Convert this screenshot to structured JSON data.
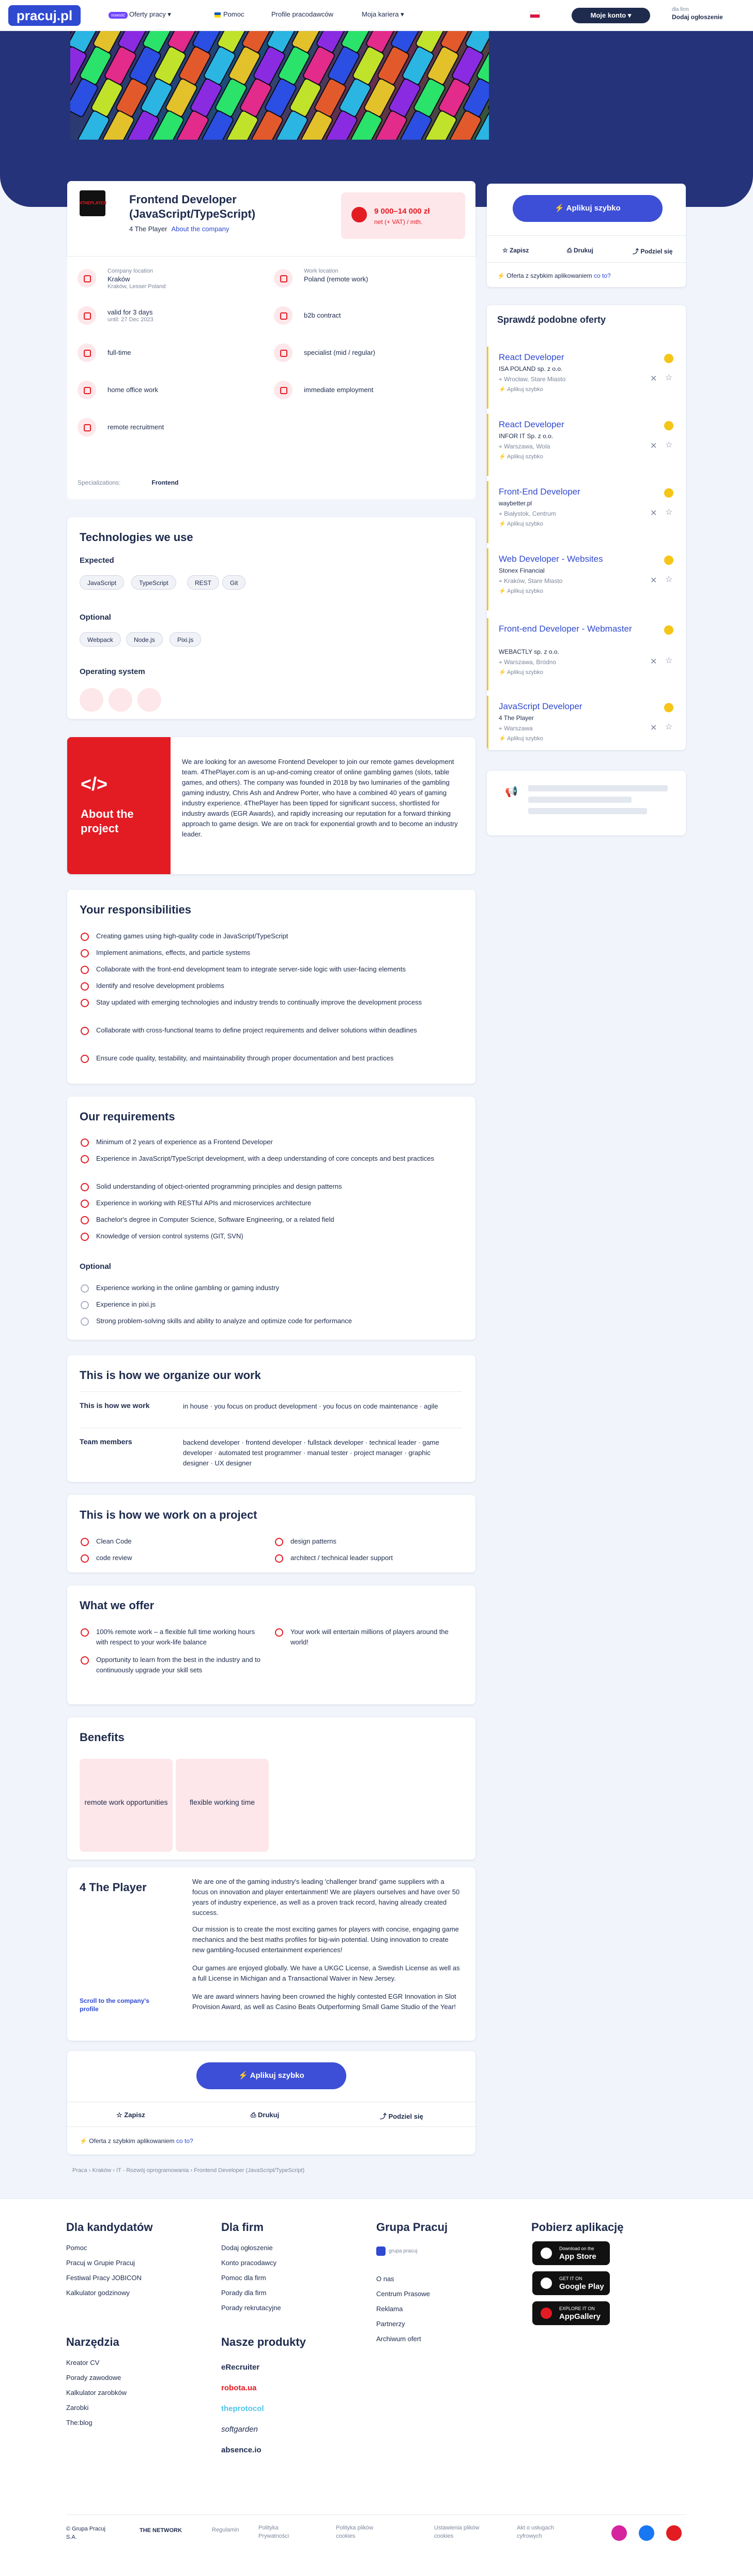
{
  "nav": {
    "logo": "pracuj.pl",
    "badge": "nowość",
    "items": [
      "Oferty pracy",
      "Pomoc",
      "Profile pracodawców",
      "Moja kariera"
    ],
    "employer_btn": "Moje konto",
    "firm_small": "dla firm",
    "firm_big": "Dodaj ogłoszenie"
  },
  "offer": {
    "company_logo": "4THEPLAYER",
    "title": "Frontend Developer (JavaScript/TypeScript)",
    "company": "4 The Player",
    "about_link": "About the company",
    "salary": "9 000–14 000 zł",
    "salary_note": "net (+ VAT) / mth."
  },
  "details": [
    {
      "title": "Company location",
      "value": "Kraków",
      "sub": "Kraków, Lesser Poland"
    },
    {
      "title": "Work location",
      "value": "Poland (remote work)",
      "sub": ""
    },
    {
      "value": "valid for 3 days",
      "sub": "until: 27 Dec 2023"
    },
    {
      "value": "b2b contract"
    },
    {
      "value": "full-time"
    },
    {
      "value": "specialist (mid / regular)"
    },
    {
      "value": "home office work"
    },
    {
      "value": "immediate employment"
    },
    {
      "value": "remote recruitment"
    }
  ],
  "specializations": {
    "label": "Specializations:",
    "value": "Frontend"
  },
  "tech": {
    "title": "Technologies we use",
    "expected": "Expected",
    "expected_items": [
      "JavaScript",
      "TypeScript",
      "REST",
      "Git"
    ],
    "optional": "Optional",
    "optional_items": [
      "Webpack",
      "Node.js",
      "Pixi.js"
    ],
    "os": "Operating system"
  },
  "project": {
    "title": "About the project",
    "text": "We are looking for an awesome Frontend Developer to join our remote games development team. 4ThePlayer.com is an up-and-coming creator of online gambling games (slots, table games, and others). The company was founded in 2018 by two luminaries of the gambling gaming industry, Chris Ash and Andrew Porter, who have a combined 40 years of gaming industry experience. 4ThePlayer has been tipped for significant success, shortlisted for industry awards (EGR Awards), and rapidly increasing our reputation for a forward thinking approach to game design. We are on track for exponential growth and to become an industry leader."
  },
  "responsibilities": {
    "title": "Your responsibilities",
    "items": [
      "Creating games using high-quality code in JavaScript/TypeScript",
      "Implement animations, effects, and particle systems",
      "Collaborate with the front-end development team to integrate server-side logic with user-facing elements",
      "Identify and resolve development problems",
      "Stay updated with emerging technologies and industry trends to continually improve the development process",
      "Collaborate with cross-functional teams to define project requirements and deliver solutions within deadlines",
      "Ensure code quality, testability, and maintainability through proper documentation and best practices"
    ]
  },
  "requirements": {
    "title": "Our requirements",
    "items": [
      "Minimum of 2 years of experience as a Frontend Developer",
      "Experience in JavaScript/TypeScript development, with a deep understanding of core concepts and best practices",
      "Solid understanding of object-oriented programming principles and design patterns",
      "Experience in working with RESTful APIs and microservices architecture",
      "Bachelor's degree in Computer Science, Software Engineering, or a related field",
      "Knowledge of version control systems (GIT, SVN)"
    ],
    "optional": "Optional",
    "optional_items": [
      "Experience working in the online gambling or gaming industry",
      "Experience in pixi.js",
      "Strong problem-solving skills and ability to analyze and optimize code for performance"
    ]
  },
  "organize": {
    "title": "This is how we organize our work",
    "work_label": "This is how we work",
    "work_value": "in house · you focus on product development · you focus on code maintenance · agile",
    "team_label": "Team members",
    "team_value": "backend developer · frontend developer · fullstack developer · technical leader · game developer · automated test programmer · manual tester · project manager · graphic designer · UX designer"
  },
  "onproject": {
    "title": "This is how we work on a project",
    "items": [
      "Clean Code",
      "design patterns",
      "code review",
      "architect / technical leader support"
    ]
  },
  "offer_list": {
    "title": "What we offer",
    "items": [
      "100% remote work – a flexible full time working hours with respect to your work-life balance",
      "Your work will entertain millions of players around the world!",
      "Opportunity to learn from the best in the industry and to continuously upgrade your skill sets"
    ]
  },
  "benefits": {
    "title": "Benefits",
    "items": [
      "remote work opportunities",
      "flexible working time"
    ]
  },
  "company": {
    "name": "4 The Player",
    "scroll": "Scroll to the company's profile",
    "p1": "We are one of the gaming industry's leading 'challenger brand' game suppliers with a focus on innovation and player entertainment! We are players ourselves and have over 50 years of industry experience, as well as a proven track record, having already created success.",
    "p2": "Our mission is to create the most exciting games for players with concise, engaging game mechanics and the best maths profiles for big-win potential. Using innovation to create new gambling-focused entertainment experiences!",
    "p3": "Our games are enjoyed globally. We have a UKGC License, a Swedish License as well as a full License in Michigan and a Transactional Waiver in New Jersey.",
    "p4": "We are award winners having been crowned the highly contested EGR Innovation in Slot Provision Award, as well as Casino Beats Outperforming Small Game Studio of the Year!"
  },
  "actions": {
    "apply": "Aplikuj szybko",
    "save": "Zapisz",
    "print": "Drukuj",
    "share": "Podziel się",
    "quick": "Oferta z szybkim aplikowaniem",
    "quick_link": "co to?"
  },
  "breadcrumb": [
    "Praca",
    "Kraków",
    "IT - Rozwój oprogramowania",
    "Frontend Developer (JavaScript/TypeScript)"
  ],
  "similar": {
    "title": "Sprawdź podobne oferty",
    "items": [
      {
        "t": "React Developer",
        "c": "ISA POLAND sp. z o.o.",
        "l": "Wrocław, Stare Miasto"
      },
      {
        "t": "React Developer",
        "c": "INFOR IT Sp. z o.o.",
        "l": "Warszawa, Wola"
      },
      {
        "t": "Front-End Developer",
        "c": "waybetter.pl",
        "l": "Białystok, Centrum"
      },
      {
        "t": "Web Developer - Websites",
        "c": "Stonex Financial",
        "l": "Kraków, Stare Miasto"
      },
      {
        "t": "Front-end Developer - Webmaster",
        "c": "WEBACTLY sp. z o.o.",
        "l": "Warszawa, Bródno"
      },
      {
        "t": "JavaScript Developer",
        "c": "4 The Player",
        "l": "Warszawa"
      }
    ],
    "apply_quick": "Aplikuj szybko"
  },
  "footer": {
    "candidates": "Dla kandydatów",
    "cand_items": [
      "Pomoc",
      "Pracuj w Grupie Pracuj",
      "Festiwal Pracy JOBICON",
      "Kalkulator godzinowy"
    ],
    "firms": "Dla firm",
    "firm_items": [
      "Dodaj ogłoszenie",
      "Konto pracodawcy",
      "Pomoc dla firm",
      "Porady dla firm",
      "Porady rekrutacyjne"
    ],
    "group": "Grupa Pracuj",
    "group_items": [
      "O nas",
      "Centrum Prasowe",
      "Reklama",
      "Partnerzy",
      "Archiwum ofert"
    ],
    "app": "Pobierz aplikację",
    "stores": [
      {
        "s": "Download on the",
        "b": "App Store"
      },
      {
        "s": "GET IT ON",
        "b": "Google Play"
      },
      {
        "s": "EXPLORE IT ON",
        "b": "AppGallery"
      }
    ],
    "tools": "Narzędzia",
    "tool_items": [
      "Kreator CV",
      "Porady zawodowe",
      "Kalkulator zarobków",
      "Zarobki",
      "The:blog"
    ],
    "products": "Nasze produkty",
    "product_items": [
      "eRecruiter",
      "robota.ua",
      "theprotocol",
      "softgarden",
      "absence.io"
    ],
    "copyright": "© Grupa Pracuj S.A.",
    "network": "THE NETWORK",
    "links": [
      "Regulamin",
      "Polityka Prywatności",
      "Polityka plików cookies",
      "Ustawienia plików cookies",
      "Akt o usługach cyfrowych"
    ],
    "group_logo": "grupa pracuj"
  },
  "colors": {
    "brand": "#2f49d1",
    "accent": "#e31b23",
    "navy": "#1e2b4d"
  }
}
